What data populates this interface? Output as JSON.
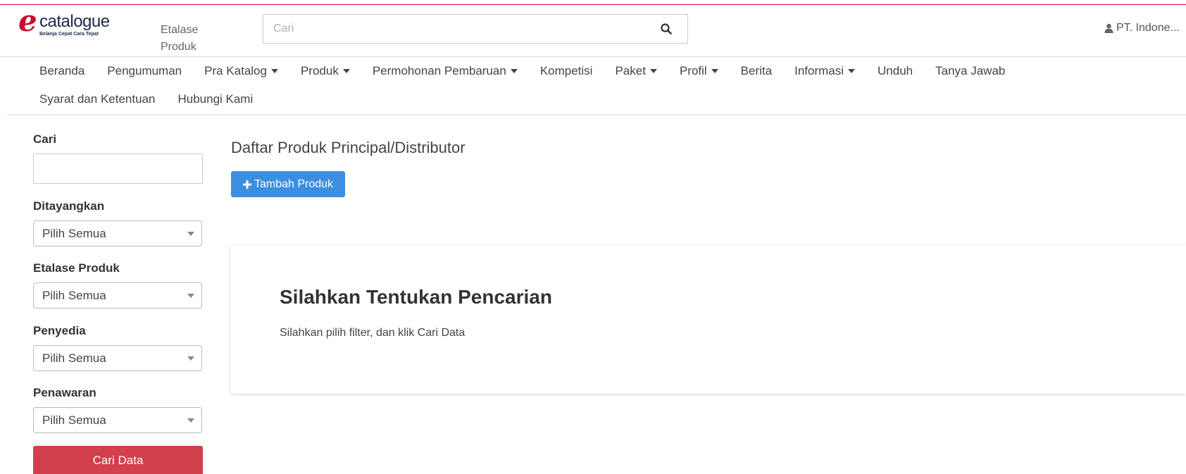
{
  "header": {
    "logo": {
      "letter": "e",
      "word": "catalogue",
      "tagline": "Belanja Cepat Cara Tepat"
    },
    "etalase_line1": "Etalase",
    "etalase_line2": "Produk",
    "search": {
      "placeholder": "Cari",
      "value": ""
    },
    "user": "PT. Indone..."
  },
  "nav": {
    "row1": [
      {
        "label": "Beranda",
        "dropdown": false
      },
      {
        "label": "Pengumuman",
        "dropdown": false
      },
      {
        "label": "Pra Katalog",
        "dropdown": true
      },
      {
        "label": "Produk",
        "dropdown": true
      },
      {
        "label": "Permohonan Pembaruan",
        "dropdown": true
      },
      {
        "label": "Kompetisi",
        "dropdown": false
      },
      {
        "label": "Paket",
        "dropdown": true
      },
      {
        "label": "Profil",
        "dropdown": true
      },
      {
        "label": "Berita",
        "dropdown": false
      },
      {
        "label": "Informasi",
        "dropdown": true
      },
      {
        "label": "Unduh",
        "dropdown": false
      },
      {
        "label": "Tanya Jawab",
        "dropdown": false
      }
    ],
    "row2": [
      {
        "label": "Syarat dan Ketentuan",
        "dropdown": false
      },
      {
        "label": "Hubungi Kami",
        "dropdown": false
      }
    ]
  },
  "sidebar": {
    "cari_label": "Cari",
    "cari_value": "",
    "ditayangkan_label": "Ditayangkan",
    "ditayangkan_value": "Pilih Semua",
    "etalase_label": "Etalase Produk",
    "etalase_value": "Pilih Semua",
    "penyedia_label": "Penyedia",
    "penyedia_value": "Pilih Semua",
    "penawaran_label": "Penawaran",
    "penawaran_value": "Pilih Semua",
    "submit_label": "Cari Data"
  },
  "main": {
    "title": "Daftar Produk Principal/Distributor",
    "add_button": "Tambah Produk",
    "panel_title": "Silahkan Tentukan Pencarian",
    "panel_text": "Silahkan pilih filter, dan klik Cari Data"
  },
  "colors": {
    "brand_red": "#c8102e",
    "primary_blue": "#3c8ee0",
    "danger_red": "#d23f4d"
  },
  "icons": {
    "search": "search-icon",
    "user": "user-icon",
    "add": "plus-icon",
    "dropdown": "caret-down-icon"
  }
}
